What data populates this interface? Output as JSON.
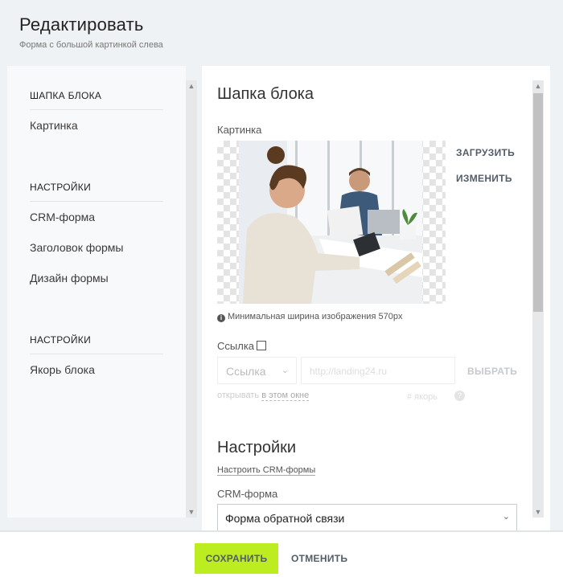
{
  "header": {
    "title": "Редактировать",
    "subtitle": "Форма с большой картинкой слева"
  },
  "sidebar": {
    "groups": [
      {
        "heading": "ШАПКА БЛОКА",
        "items": [
          "Картинка"
        ]
      },
      {
        "heading": "НАСТРОЙКИ",
        "items": [
          "CRM-форма",
          "Заголовок формы",
          "Дизайн формы"
        ]
      },
      {
        "heading": "НАСТРОЙКИ",
        "items": [
          "Якорь блока"
        ]
      }
    ]
  },
  "main": {
    "block_header": {
      "title": "Шапка блока",
      "picture_label": "Картинка",
      "upload_label": "ЗАГРУЗИТЬ",
      "change_label": "ИЗМЕНИТЬ",
      "hint_icon": "info-icon",
      "min_width_hint": "Минимальная ширина изображения 570px"
    },
    "link": {
      "label": "Ссылка",
      "type_value": "Ссылка",
      "url_placeholder": "http://landing24.ru",
      "choose_label": "ВЫБРАТЬ",
      "open_prefix": "открывать",
      "open_value": "в этом окне",
      "anchor_text": "# якорь",
      "help_icon": "?"
    },
    "settings": {
      "title": "Настройки",
      "configure_link": "Настроить CRM-формы",
      "crm_label": "CRM-форма",
      "crm_value": "Форма обратной связи"
    }
  },
  "footer": {
    "save_label": "СОХРАНИТЬ",
    "cancel_label": "ОТМЕНИТЬ"
  },
  "colors": {
    "accent_save": "#bbed21",
    "button_text": "#535c69",
    "background": "#eef2f4"
  }
}
